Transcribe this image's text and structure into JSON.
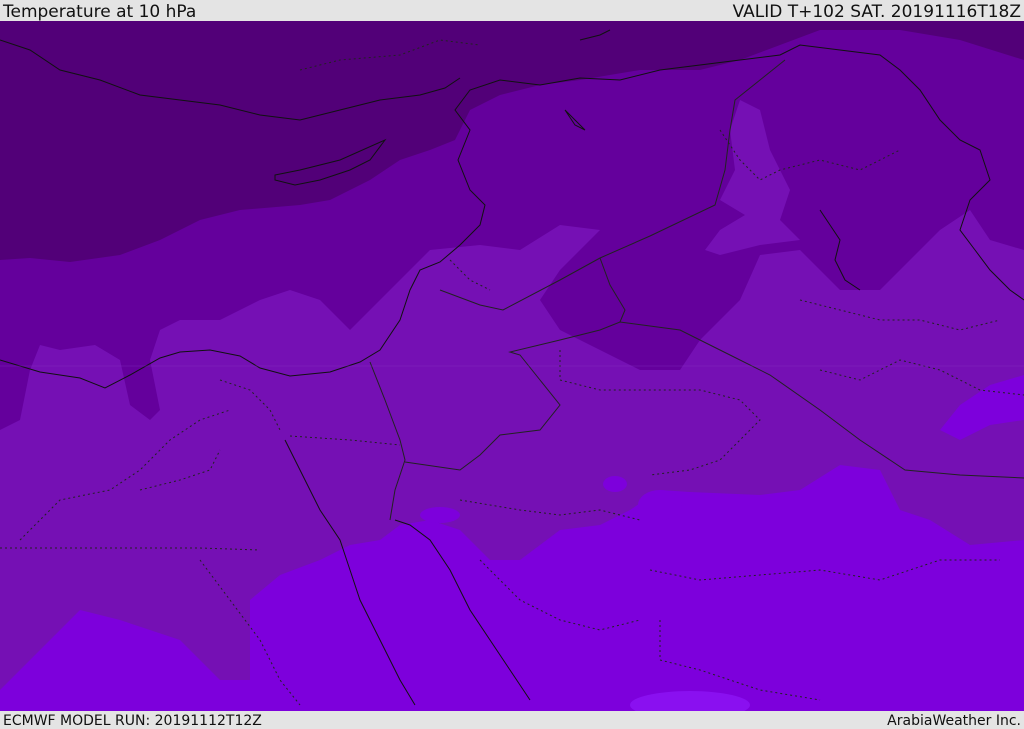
{
  "header": {
    "title": "Temperature at 10 hPa",
    "valid": "VALID T+102 SAT. 20191116T18Z"
  },
  "footer": {
    "model_run": "ECMWF MODEL RUN: 20191112T12Z",
    "credit": "ArabiaWeather Inc."
  },
  "map": {
    "fill_colors": [
      "#520078",
      "#64009c",
      "#7510b4",
      "#7d00dc",
      "#8a10f0"
    ],
    "coastline_color": "#111111",
    "border_color": "#222222"
  }
}
